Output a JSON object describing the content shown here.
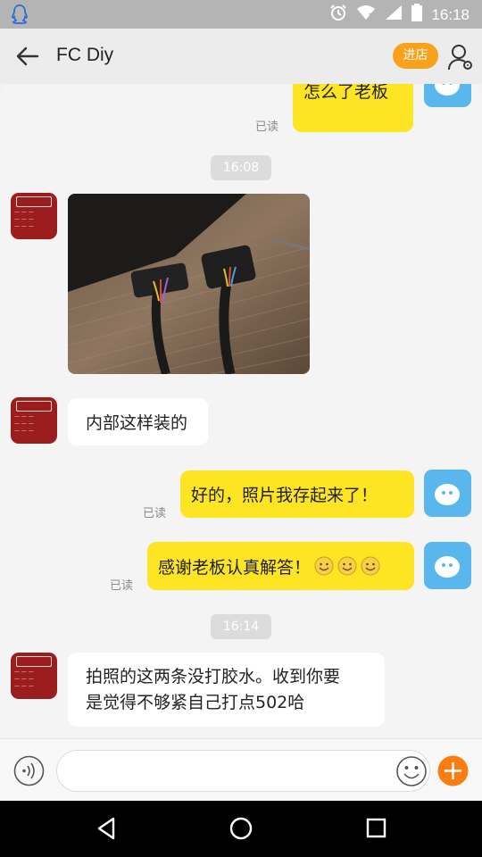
{
  "status_bar": {
    "time": "16:18",
    "icons": [
      "qq-icon",
      "alarm-icon",
      "wifi-icon",
      "signal-icon",
      "battery-icon"
    ]
  },
  "header": {
    "title": "FC Diy",
    "shop_button": "进店",
    "accent": "#f9a11b"
  },
  "messages": [
    {
      "side": "right",
      "text": "怎么了老板",
      "read": "已读",
      "partial": true
    },
    {
      "type": "time",
      "text": "16:08"
    },
    {
      "side": "left",
      "type": "image",
      "alt": "photo-of-connectors"
    },
    {
      "side": "left",
      "text": "内部这样装的"
    },
    {
      "side": "right",
      "text": "好的，照片我存起来了！",
      "read": "已读"
    },
    {
      "side": "right",
      "text": "感谢老板认真解答！",
      "emoji_count": 3,
      "read": "已读"
    },
    {
      "type": "time",
      "text": "16:14"
    },
    {
      "side": "left",
      "text_line1": "拍照的这两条没打胶水。收到你要",
      "text_line2": "是觉得不够紧自己打点502哈"
    }
  ],
  "input": {
    "value": "",
    "placeholder": ""
  },
  "colors": {
    "my_bubble": "#fde523",
    "their_bubble": "#ffffff",
    "my_avatar": "#5ab7ee",
    "their_avatar": "#9c1d1d",
    "plus_button": "#fa7d12"
  }
}
